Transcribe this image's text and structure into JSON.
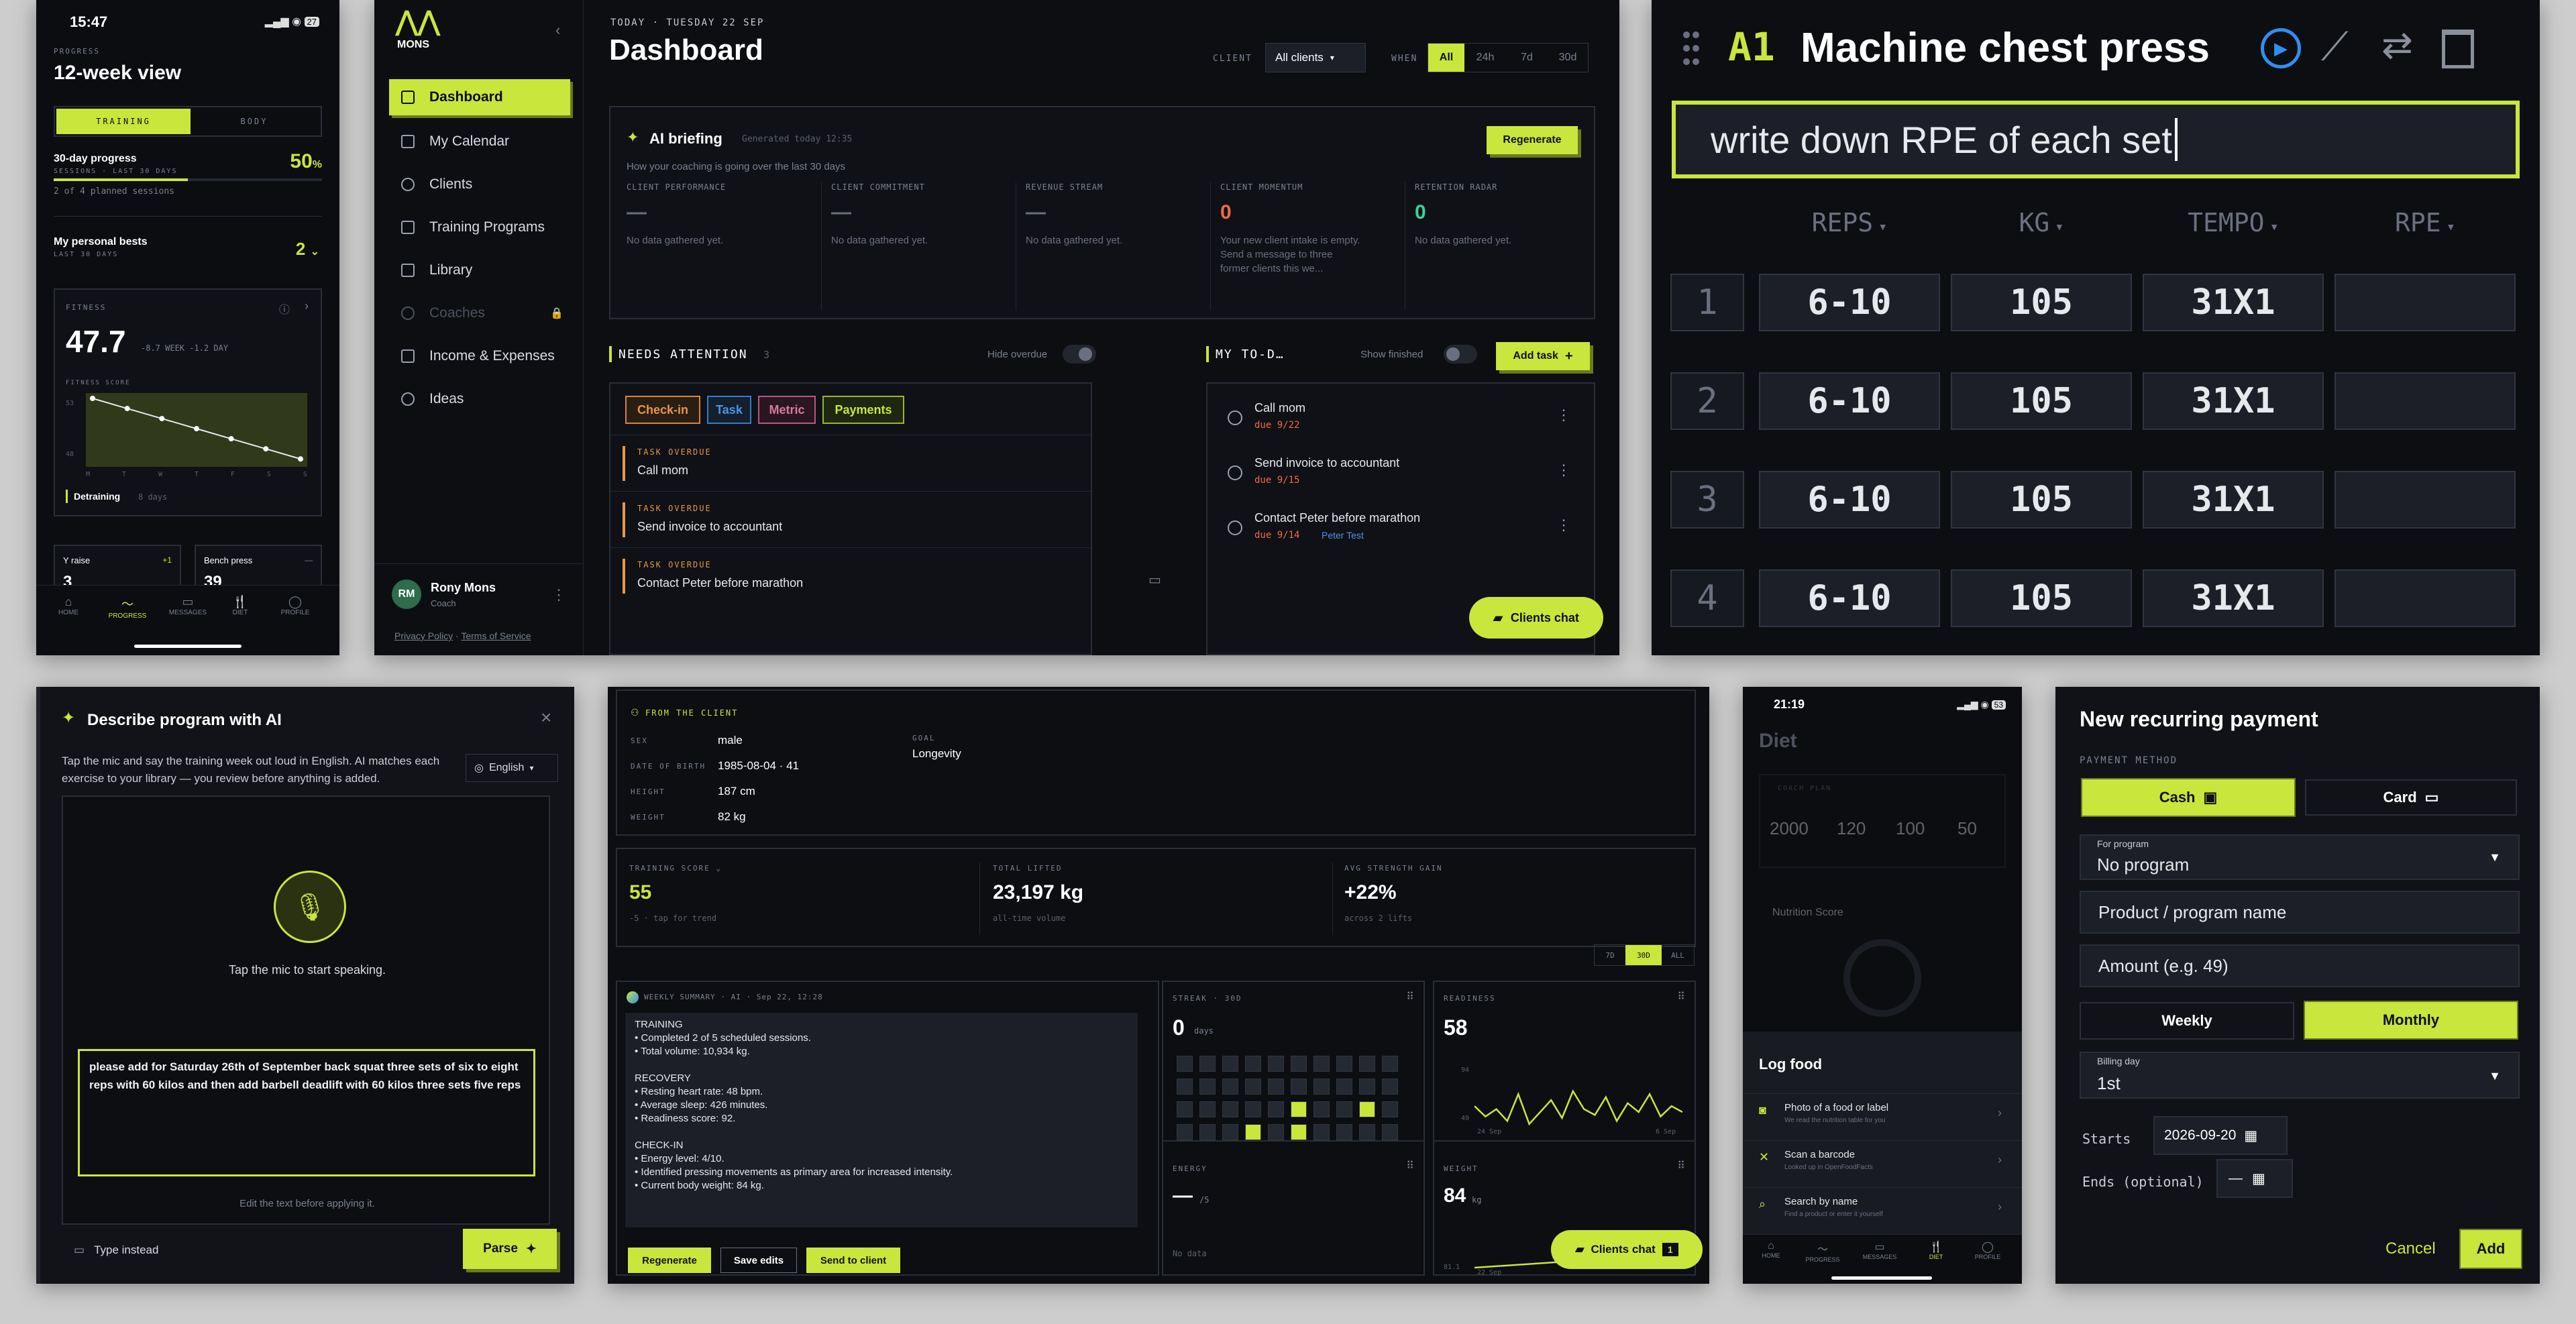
{
  "phone1": {
    "time": "15:47",
    "battery": "27",
    "eyebrow": "PROGRESS",
    "title": "12-week view",
    "tabs": [
      "TRAINING",
      "BODY"
    ],
    "progress_label": "30-day progress",
    "progress_sub": "SESSIONS · LAST 30 DAYS",
    "progress_value": "50",
    "progress_unit": "%",
    "progress_fraction": 0.5,
    "planned": "2 of 4 planned sessions",
    "bests_label": "My personal bests",
    "bests_sub": "LAST 30 DAYS",
    "bests_value": "2",
    "fitness_label": "FITNESS",
    "fitness_value": "47.7",
    "fitness_delta": "-8.7 WEEK  -1.2 DAY",
    "fitness_score": "FITNESS SCORE",
    "fitness_axis_top": "53",
    "fitness_axis_bottom": "48",
    "fitness_days": [
      "M",
      "T",
      "W",
      "T",
      "F",
      "S",
      "S"
    ],
    "fitness_series": [
      53,
      52.2,
      51.4,
      50.6,
      49.8,
      49.0,
      48.2
    ],
    "status": "Detraining",
    "status_days": "8 days",
    "lift1_name": "Y raise",
    "lift1_delta": "+1",
    "lift1_value": "3",
    "lift2_name": "Bench press",
    "lift2_delta": "—",
    "lift2_value": "39",
    "nav": [
      "HOME",
      "PROGRESS",
      "MESSAGES",
      "DIET",
      "PROFILE"
    ]
  },
  "dash": {
    "brand": "MONS",
    "date": "TODAY · TUESDAY 22 SEP",
    "title": "Dashboard",
    "client_label": "CLIENT",
    "client_value": "All clients",
    "when_label": "WHEN",
    "when_options": [
      "All",
      "24h",
      "7d",
      "30d"
    ],
    "nav": [
      "Dashboard",
      "My Calendar",
      "Clients",
      "Training Programs",
      "Library",
      "Coaches",
      "Income & Expenses",
      "Ideas"
    ],
    "user_initials": "RM",
    "user_name": "Rony Mons",
    "user_role": "Coach",
    "privacy": "Privacy Policy",
    "terms": "Terms of Service",
    "briefing_title": "AI briefing",
    "briefing_generated": "Generated today 12:35",
    "briefing_sub": "How your coaching is going over the last 30 days",
    "regenerate": "Regenerate",
    "metrics": [
      {
        "label": "CLIENT PERFORMANCE",
        "value": "—",
        "text": "No data gathered yet."
      },
      {
        "label": "CLIENT COMMITMENT",
        "value": "—",
        "text": "No data gathered yet."
      },
      {
        "label": "REVENUE STREAM",
        "value": "—",
        "text": "No data gathered yet."
      },
      {
        "label": "CLIENT MOMENTUM",
        "value": "0",
        "text": "Your new client intake is empty. Send a message to three former clients this we..."
      },
      {
        "label": "RETENTION RADAR",
        "value": "0",
        "text": "No data gathered yet."
      }
    ],
    "attention_title": "NEEDS ATTENTION",
    "attention_count": "3",
    "hide_overdue": "Hide overdue",
    "filters": [
      "Check-in",
      "Task",
      "Metric",
      "Payments"
    ],
    "overdue_tag": "TASK OVERDUE",
    "attention_items": [
      "Call mom",
      "Send invoice to accountant",
      "Contact Peter before marathon"
    ],
    "todo_title": "MY TO-D…",
    "show_finished": "Show finished",
    "add_task": "Add task",
    "todos": [
      {
        "title": "Call mom",
        "due": "due 9/22",
        "tag": ""
      },
      {
        "title": "Send invoice to accountant",
        "due": "due 9/15",
        "tag": ""
      },
      {
        "title": "Contact Peter before marathon",
        "due": "due 9/14",
        "tag": "Peter Test"
      }
    ],
    "clients_chat": "Clients chat"
  },
  "exercise": {
    "code": "A1",
    "name": "Machine chest press",
    "note": "write down RPE of each set",
    "columns": [
      "REPS",
      "KG",
      "TEMPO",
      "RPE"
    ],
    "rows": [
      {
        "n": "1",
        "reps": "6-10",
        "kg": "105",
        "tempo": "31X1",
        "rpe": ""
      },
      {
        "n": "2",
        "reps": "6-10",
        "kg": "105",
        "tempo": "31X1",
        "rpe": ""
      },
      {
        "n": "3",
        "reps": "6-10",
        "kg": "105",
        "tempo": "31X1",
        "rpe": ""
      },
      {
        "n": "4",
        "reps": "6-10",
        "kg": "105",
        "tempo": "31X1",
        "rpe": ""
      }
    ]
  },
  "ai_modal": {
    "title": "Describe program with AI",
    "desc": "Tap the mic and say the training week out loud in English. AI matches each exercise to your library — you review before anything is added.",
    "lang": "English",
    "mic_hint": "Tap the mic to start speaking.",
    "transcript": "please add for Saturday 26th of September back squat three sets of six to eight reps with 60 kilos and then add barbell deadlift with 60 kilos three sets five reps",
    "edit_hint": "Edit the text before applying it.",
    "type_instead": "Type instead",
    "parse": "Parse"
  },
  "client": {
    "from_label": "FROM THE CLIENT",
    "sex_label": "SEX",
    "sex": "male",
    "dob_label": "DATE OF BIRTH",
    "dob": "1985-08-04 · 41",
    "height_label": "HEIGHT",
    "height": "187 cm",
    "weight_label": "WEIGHT",
    "weight": "82 kg",
    "goal_label": "GOAL",
    "goal": "Longevity",
    "score_label": "TRAINING SCORE",
    "score": "55",
    "score_sub": "-5 · tap for trend",
    "lifted_label": "TOTAL LIFTED",
    "lifted": "23,197 kg",
    "lifted_sub": "all-time volume",
    "gain_label": "AVG STRENGTH GAIN",
    "gain": "+22%",
    "gain_sub": "across 2 lifts",
    "ranges": [
      "7D",
      "30D",
      "ALL"
    ],
    "summary_label": "WEEKLY SUMMARY · AI · Sep 22, 12:28",
    "summary": [
      "TRAINING",
      "• Completed 2 of 5 scheduled sessions.",
      "• Total volume: 10,934 kg.",
      "",
      "RECOVERY",
      "• Resting heart rate: 48 bpm.",
      "• Average sleep: 426 minutes.",
      "• Readiness score: 92.",
      "",
      "CHECK-IN",
      "• Energy level: 4/10.",
      "• Identified pressing movements as primary area for increased intensity.",
      "• Current body weight: 84 kg."
    ],
    "btn_regen": "Regenerate",
    "btn_save": "Save edits",
    "btn_send": "Send to client",
    "streak_label": "STREAK · 30D",
    "streak": "0",
    "streak_unit": "days",
    "readiness_label": "READINESS",
    "readiness": "58",
    "readiness_top": "94",
    "readiness_bottom": "49",
    "readiness_from": "24 Sep",
    "readiness_to": "6 Sep",
    "readiness_series": [
      62,
      55,
      60,
      52,
      70,
      50,
      58,
      66,
      54,
      72,
      60,
      56,
      68,
      52,
      64,
      58,
      70,
      55,
      62,
      58
    ],
    "energy_label": "ENERGY",
    "energy": "—",
    "energy_unit": "/5",
    "energy_empty": "No data",
    "weight_card_label": "WEIGHT",
    "weight_card": "84",
    "weight_card_unit": "kg",
    "weight_bottom": "81.1",
    "weight_from": "22 Sep",
    "chat": "Clients chat",
    "chat_count": "1"
  },
  "diet": {
    "time": "21:19",
    "battery": "53",
    "title": "Diet",
    "plan_label": "COACH PLAN",
    "macros": [
      "2000",
      "120",
      "100",
      "50"
    ],
    "nutrition_label": "Nutrition Score",
    "log_title": "Log food",
    "log_items": [
      {
        "title": "Photo of a food or label",
        "sub": "We read the nutrition table for you"
      },
      {
        "title": "Scan a barcode",
        "sub": "Looked up in OpenFoodFacts"
      },
      {
        "title": "Search by name",
        "sub": "Find a product or enter it yourself"
      }
    ],
    "nav": [
      "HOME",
      "PROGRESS",
      "MESSAGES",
      "DIET",
      "PROFILE"
    ]
  },
  "payment": {
    "title": "New recurring payment",
    "method_label": "PAYMENT METHOD",
    "cash": "Cash",
    "card": "Card",
    "program_label": "For program",
    "program_value": "No program",
    "name_placeholder": "Product / program name",
    "amount_placeholder": "Amount (e.g. 49)",
    "weekly": "Weekly",
    "monthly": "Monthly",
    "billing_label": "Billing day",
    "billing_value": "1st",
    "starts_label": "Starts",
    "starts_value": "2026-09-20",
    "ends_label": "Ends (optional)",
    "ends_value": "—",
    "cancel": "Cancel",
    "add": "Add"
  }
}
